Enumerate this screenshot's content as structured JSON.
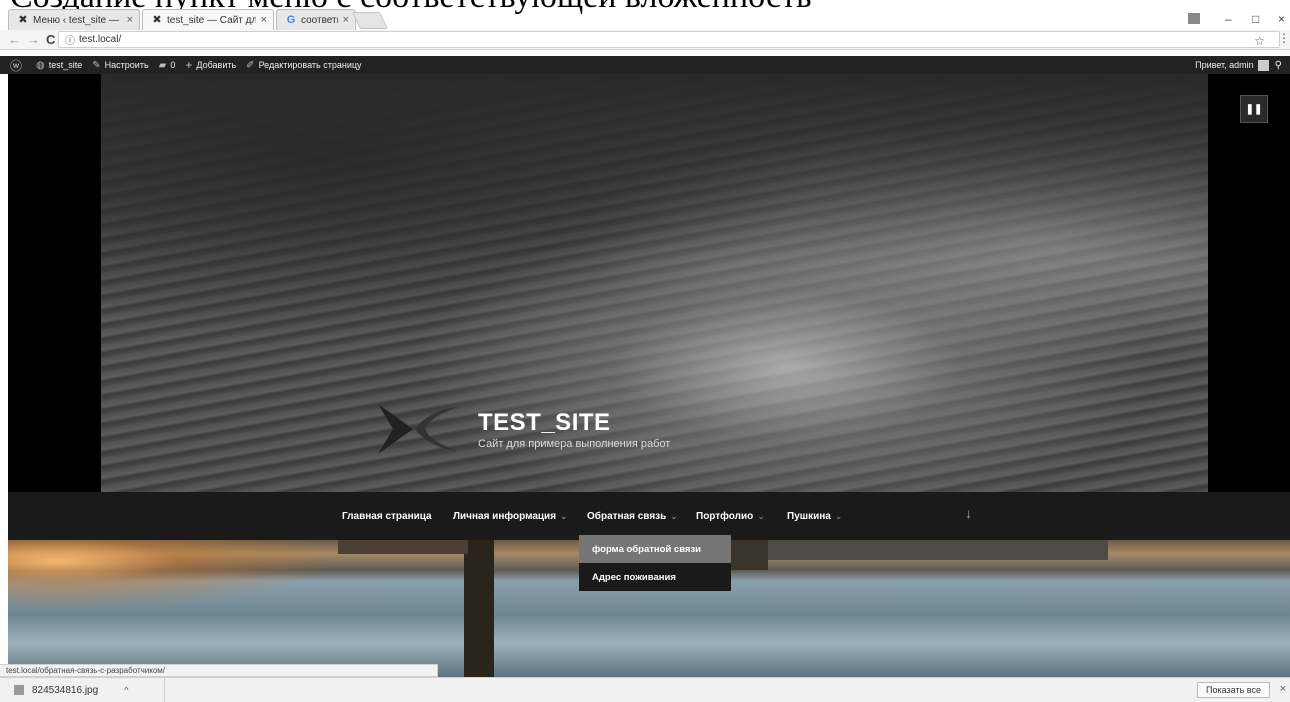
{
  "doc_heading": "Создание пункт меню с соответствующей вложенность",
  "browser": {
    "tabs": [
      {
        "title": "Меню ‹ test_site — Word",
        "active": false
      },
      {
        "title": "test_site — Сайт для при",
        "active": true
      },
      {
        "title": "соответвующей - Поиск",
        "active": false
      }
    ],
    "url": "test.local/",
    "window_controls": [
      "–",
      "□",
      "×"
    ]
  },
  "adminbar": {
    "site": "test_site",
    "customize": "Настроить",
    "comments_count": "0",
    "add_new": "Добавить",
    "edit_page": "Редактировать страницу",
    "greeting": "Привет, admin"
  },
  "hero": {
    "site_title": "TEST_SITE",
    "site_description": "Сайт для примера выполнения работ",
    "pause_icon": "pause-icon"
  },
  "menu": {
    "items": [
      {
        "label": "Главная страница"
      },
      {
        "label": "Личная информация"
      },
      {
        "label": "Обратная связь"
      },
      {
        "label": "Портфолио"
      },
      {
        "label": "Пушкина"
      }
    ],
    "submenu": [
      {
        "label": "форма обратной связи",
        "hover": true
      },
      {
        "label": "Адрес поживания",
        "hover": false
      }
    ]
  },
  "status_url": "test.local/обратная-связь-с-разработчиком/",
  "downloads": {
    "file": "824534816.jpg",
    "show_all": "Показать все"
  }
}
